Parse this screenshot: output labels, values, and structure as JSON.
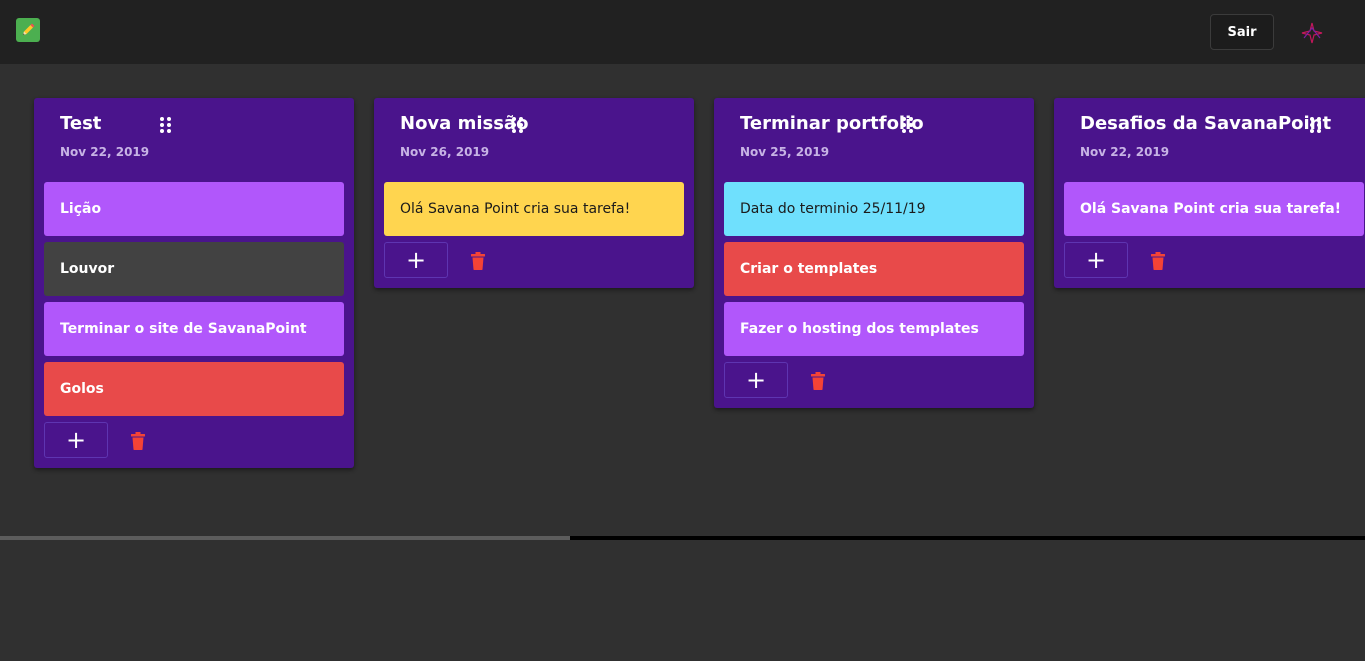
{
  "header": {
    "logout_label": "Sair",
    "logo_icon": "pencil-icon",
    "brand_icon": "brand-logo-icon"
  },
  "columns": [
    {
      "title": "Test",
      "date": "Nov 22, 2019",
      "cards": [
        {
          "text": "Lição",
          "color": "#b157fb"
        },
        {
          "text": "Louvor",
          "color": "#424242"
        },
        {
          "text": "Terminar o site de SavanaPoint",
          "color": "#b157fb"
        },
        {
          "text": "Golos",
          "color": "#e84a4a"
        }
      ]
    },
    {
      "title": "Nova missão",
      "date": "Nov 26, 2019",
      "cards": [
        {
          "text": "Olá Savana Point cria sua tarefa!",
          "color": "#ffd54f"
        }
      ]
    },
    {
      "title": "Terminar portfolio",
      "date": "Nov 25, 2019",
      "cards": [
        {
          "text": "Data do terminio 25/11/19",
          "color": "#6fe0fd"
        },
        {
          "text": "Criar o templates",
          "color": "#e84a4a"
        },
        {
          "text": "Fazer o hosting dos templates",
          "color": "#b157fb"
        }
      ]
    },
    {
      "title": "Desafios da SavanaPoint",
      "date": "Nov 22, 2019",
      "cards": [
        {
          "text": "Olá Savana Point cria sua tarefa!",
          "color": "#b157fb"
        }
      ]
    }
  ],
  "column_actions": {
    "add_label": "+",
    "add_icon": "plus-icon",
    "delete_icon": "trash-icon",
    "drag_icon": "drag-handle-icon"
  },
  "colors": {
    "background": "#303030",
    "topbar": "#212121",
    "column": "#4a148c",
    "delete": "#f44336"
  }
}
